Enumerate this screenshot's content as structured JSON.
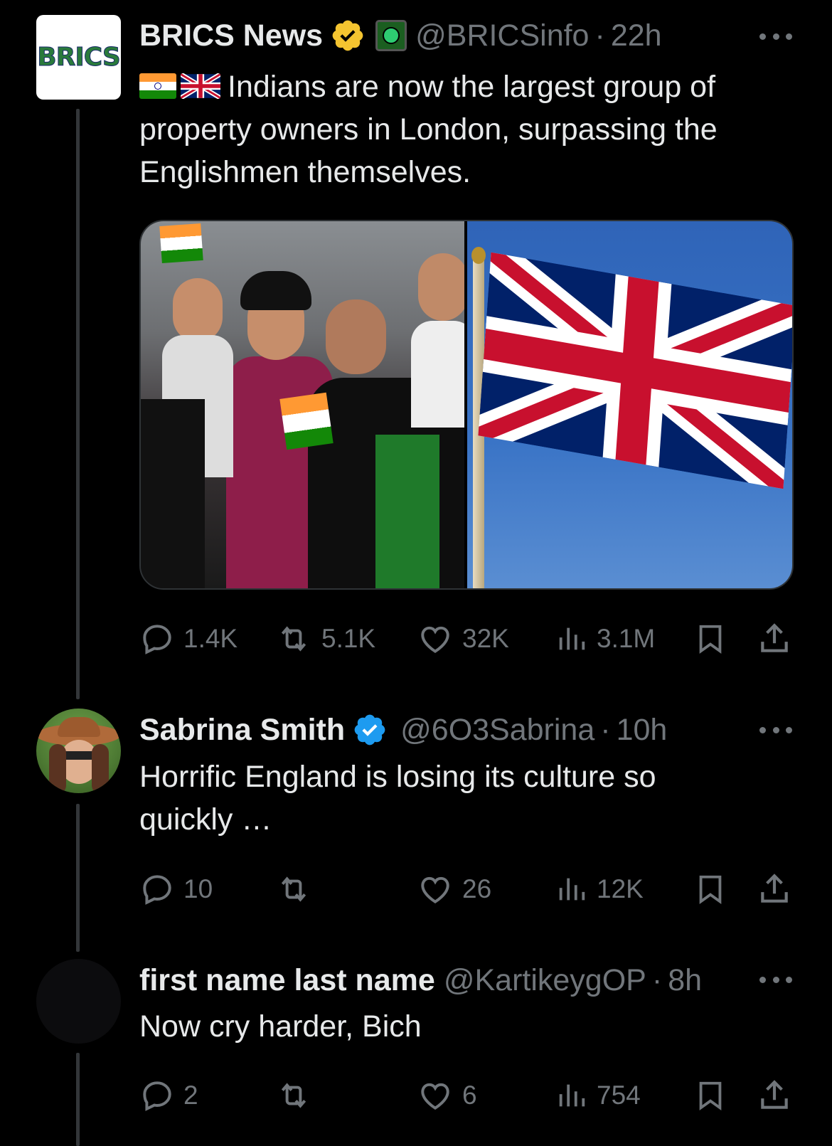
{
  "tweets": [
    {
      "display_name": "BRICS News",
      "handle": "@BRICSinfo",
      "time": "22h",
      "text": "Indians are now the largest group of property owners in London, surpassing the Englishmen themselves.",
      "avatar_text": "BRICS",
      "metrics": {
        "replies": "1.4K",
        "reposts": "5.1K",
        "likes": "32K",
        "views": "3.1M"
      }
    },
    {
      "display_name": "Sabrina Smith",
      "handle": "@6O3Sabrina",
      "time": "10h",
      "text": "Horrific England is losing its culture so quickly …",
      "metrics": {
        "replies": "10",
        "reposts": "",
        "likes": "26",
        "views": "12K"
      }
    },
    {
      "display_name": "first name last name",
      "handle": "@KartikeygOP",
      "time": "8h",
      "text": "Now cry harder, Bich",
      "metrics": {
        "replies": "2",
        "reposts": "",
        "likes": "6",
        "views": "754"
      }
    }
  ],
  "colors": {
    "background": "#000000",
    "text": "#e7e9ea",
    "muted": "#71767b",
    "verified_gold": "#f4c430",
    "verified_blue": "#1d9bf0",
    "thread_line": "#333639"
  },
  "icons": [
    "reply-icon",
    "repost-icon",
    "like-icon",
    "views-icon",
    "bookmark-icon",
    "share-icon",
    "more-icon",
    "verified-badge-icon",
    "affiliate-badge-icon"
  ]
}
